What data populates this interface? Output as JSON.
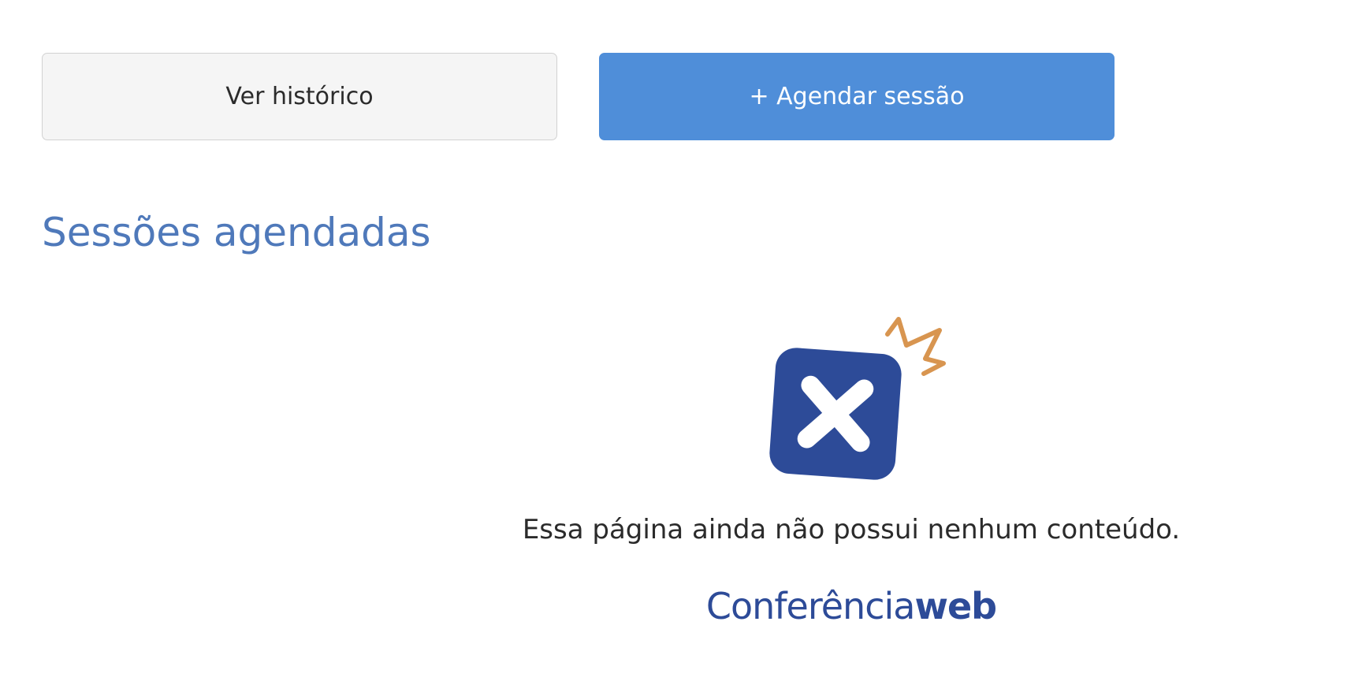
{
  "actions": {
    "history_label": "Ver histórico",
    "schedule_label": "+ Agendar sessão"
  },
  "section": {
    "title": "Sessões agendadas"
  },
  "empty_state": {
    "icon": "close-square-icon",
    "message": "Essa página ainda não possui nenhum conteúdo.",
    "brand_light": "Conferência",
    "brand_bold": "web"
  },
  "colors": {
    "primary_button": "#4f8ed9",
    "title": "#4f79ba",
    "icon_square": "#2d4b98",
    "icon_accent": "#d89550"
  }
}
